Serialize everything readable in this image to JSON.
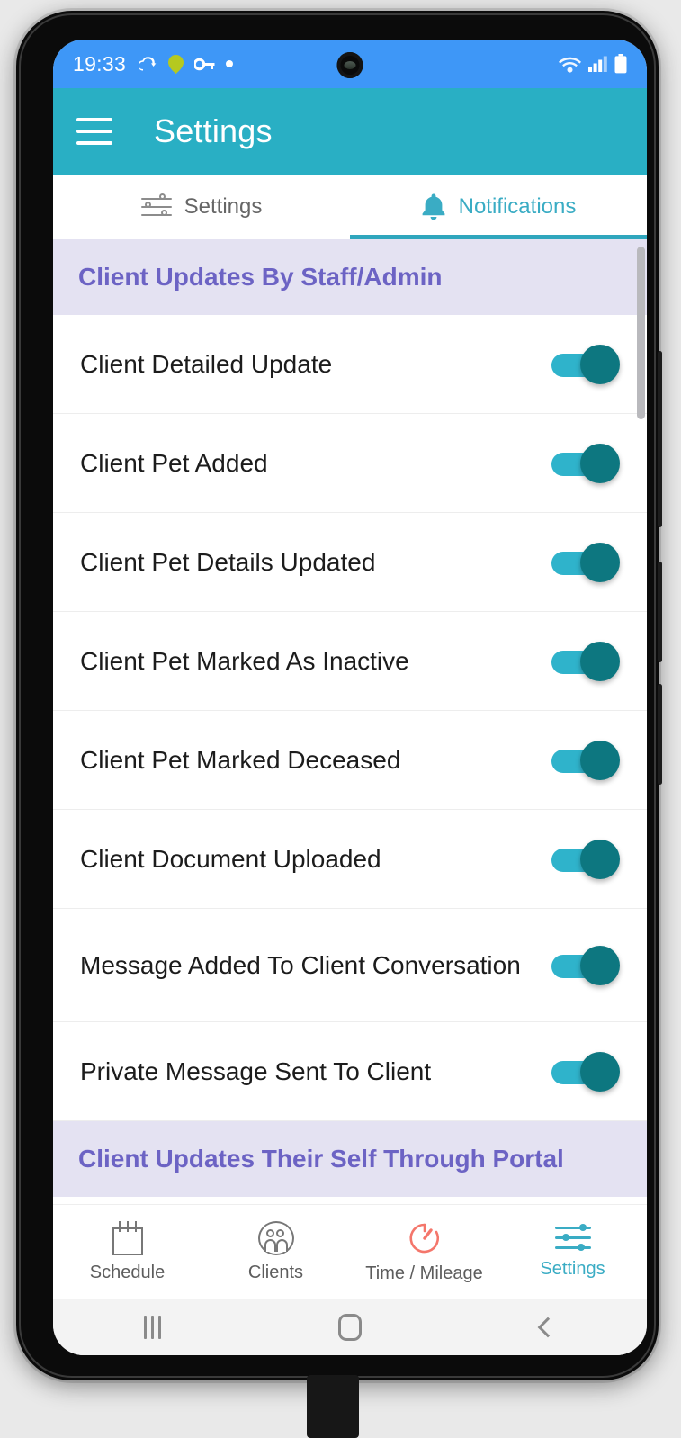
{
  "status_bar": {
    "time": "19:33",
    "left_icons": [
      "cloud-sync-icon",
      "location-icon",
      "vpn-key-icon",
      "dot-icon"
    ],
    "right_icons": [
      "wifi-icon",
      "cellular-signal-icon",
      "battery-icon"
    ]
  },
  "app_bar": {
    "menu_icon": "hamburger-menu-icon",
    "title": "Settings"
  },
  "tabs": [
    {
      "label": "Settings",
      "icon": "sliders-icon",
      "active": false
    },
    {
      "label": "Notifications",
      "icon": "bell-icon",
      "active": true
    }
  ],
  "sections": [
    {
      "header": "Client Updates By Staff/Admin",
      "rows": [
        {
          "label": "Client Detailed Update",
          "enabled": true
        },
        {
          "label": "Client Pet Added",
          "enabled": true
        },
        {
          "label": "Client Pet Details Updated",
          "enabled": true
        },
        {
          "label": "Client Pet Marked As Inactive",
          "enabled": true
        },
        {
          "label": "Client Pet Marked Deceased",
          "enabled": true
        },
        {
          "label": "Client Document Uploaded",
          "enabled": true
        },
        {
          "label": "Message Added To Client Conversation",
          "enabled": true
        },
        {
          "label": "Private Message Sent To Client",
          "enabled": true
        }
      ]
    },
    {
      "header": "Client Updates Their Self Through Portal",
      "rows": []
    }
  ],
  "bottom_nav": [
    {
      "label": "Schedule",
      "icon": "calendar-icon",
      "active": false
    },
    {
      "label": "Clients",
      "icon": "people-icon",
      "active": false
    },
    {
      "label": "Time / Mileage",
      "icon": "timer-icon",
      "active": false
    },
    {
      "label": "Settings",
      "icon": "sliders-icon",
      "active": true
    }
  ],
  "android_nav": [
    {
      "icon": "recents-icon"
    },
    {
      "icon": "home-icon"
    },
    {
      "icon": "back-icon"
    }
  ],
  "colors": {
    "app_bar": "#29afc4",
    "status_bar": "#3e97f7",
    "accent": "#3aacc4",
    "section_header_bg": "#e4e2f2",
    "section_header_text": "#6c63c4",
    "toggle_track": "#2fb3cb",
    "toggle_thumb": "#0d7780",
    "timer_icon": "#f4766b"
  }
}
